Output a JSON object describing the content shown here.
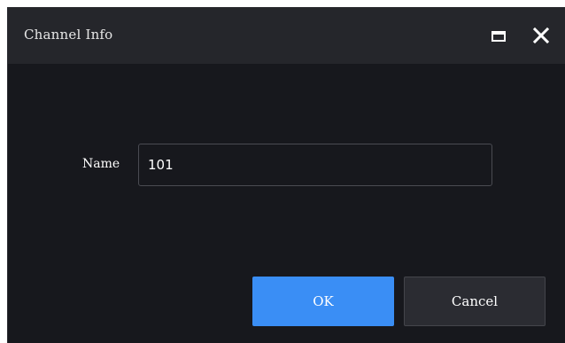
{
  "dialog": {
    "title": "Channel Info",
    "maximize_icon": "maximize-icon",
    "close_icon": "close-icon"
  },
  "form": {
    "name_label": "Name",
    "name_value": "101"
  },
  "buttons": {
    "ok_label": "OK",
    "cancel_label": "Cancel"
  },
  "colors": {
    "dialog_background": "#17181d",
    "titlebar_background": "#25262b",
    "primary_button": "#3a8ef5",
    "secondary_button": "#2b2c32"
  }
}
